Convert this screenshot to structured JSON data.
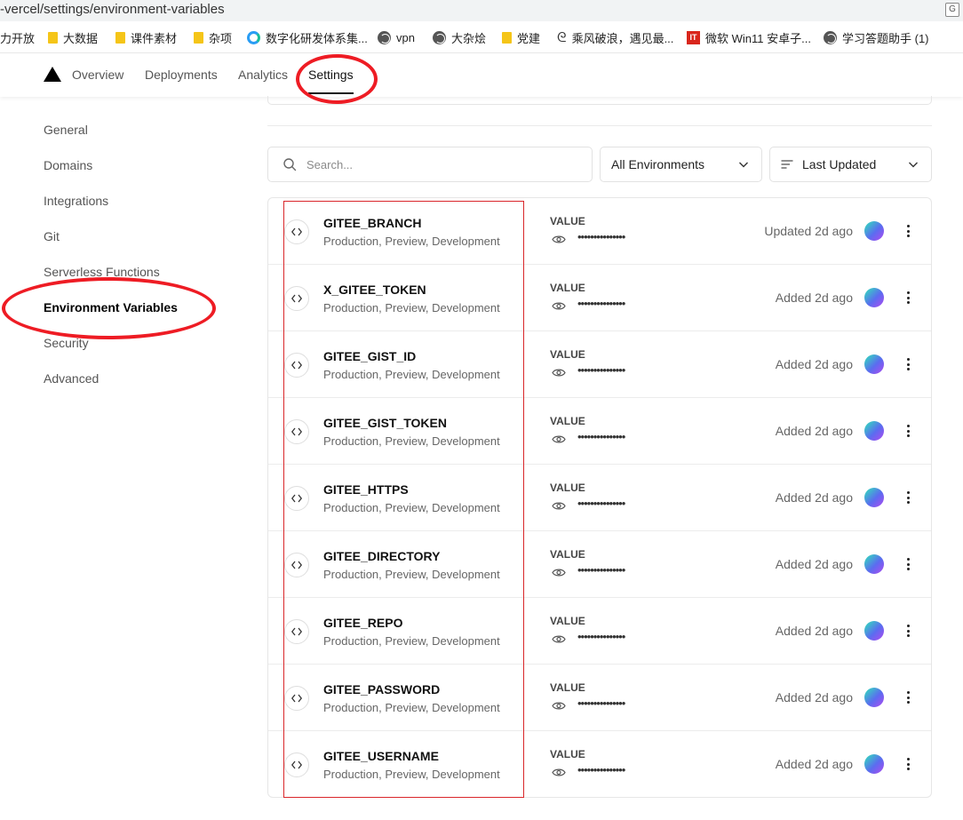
{
  "browser": {
    "url": "-vercel/settings/environment-variables",
    "bookmarks": [
      {
        "label": "力开放",
        "icon": "none"
      },
      {
        "label": "大数据",
        "icon": "folder-icon"
      },
      {
        "label": "课件素材",
        "icon": "folder-icon"
      },
      {
        "label": "杂项",
        "icon": "folder-icon"
      },
      {
        "label": "数字化研发体系集...",
        "icon": "ring-icon"
      },
      {
        "label": "vpn",
        "icon": "globe-icon"
      },
      {
        "label": "大杂烩",
        "icon": "globe-icon"
      },
      {
        "label": "党建",
        "icon": "folder-icon"
      },
      {
        "label": "乘风破浪，遇见最...",
        "icon": "curl-icon"
      },
      {
        "label": "微软 Win11 安卓子...",
        "icon": "it-icon"
      },
      {
        "label": "学习答题助手 (1)",
        "icon": "globe-icon"
      }
    ]
  },
  "nav": {
    "tabs": [
      "Overview",
      "Deployments",
      "Analytics",
      "Settings"
    ],
    "active": "Settings"
  },
  "sidebar": {
    "items": [
      "General",
      "Domains",
      "Integrations",
      "Git",
      "Serverless Functions",
      "Environment Variables",
      "Security",
      "Advanced"
    ],
    "active": "Environment Variables"
  },
  "filters": {
    "search_placeholder": "Search...",
    "environment": "All Environments",
    "sort": "Last Updated"
  },
  "env_vars": [
    {
      "name": "GITEE_BRANCH",
      "environments": "Production, Preview, Development",
      "value_label": "VALUE",
      "masked": "•••••••••••••••",
      "status": "Updated 2d ago"
    },
    {
      "name": "X_GITEE_TOKEN",
      "environments": "Production, Preview, Development",
      "value_label": "VALUE",
      "masked": "•••••••••••••••",
      "status": "Added 2d ago"
    },
    {
      "name": "GITEE_GIST_ID",
      "environments": "Production, Preview, Development",
      "value_label": "VALUE",
      "masked": "•••••••••••••••",
      "status": "Added 2d ago"
    },
    {
      "name": "GITEE_GIST_TOKEN",
      "environments": "Production, Preview, Development",
      "value_label": "VALUE",
      "masked": "•••••••••••••••",
      "status": "Added 2d ago"
    },
    {
      "name": "GITEE_HTTPS",
      "environments": "Production, Preview, Development",
      "value_label": "VALUE",
      "masked": "•••••••••••••••",
      "status": "Added 2d ago"
    },
    {
      "name": "GITEE_DIRECTORY",
      "environments": "Production, Preview, Development",
      "value_label": "VALUE",
      "masked": "•••••••••••••••",
      "status": "Added 2d ago"
    },
    {
      "name": "GITEE_REPO",
      "environments": "Production, Preview, Development",
      "value_label": "VALUE",
      "masked": "•••••••••••••••",
      "status": "Added 2d ago"
    },
    {
      "name": "GITEE_PASSWORD",
      "environments": "Production, Preview, Development",
      "value_label": "VALUE",
      "masked": "•••••••••••••••",
      "status": "Added 2d ago"
    },
    {
      "name": "GITEE_USERNAME",
      "environments": "Production, Preview, Development",
      "value_label": "VALUE",
      "masked": "•••••••••••••••",
      "status": "Added 2d ago"
    }
  ],
  "colors": {
    "annotation_red": "#ee1c24",
    "avatar_gradient_start": "#2ee6b8",
    "avatar_gradient_end": "#b04af0"
  }
}
